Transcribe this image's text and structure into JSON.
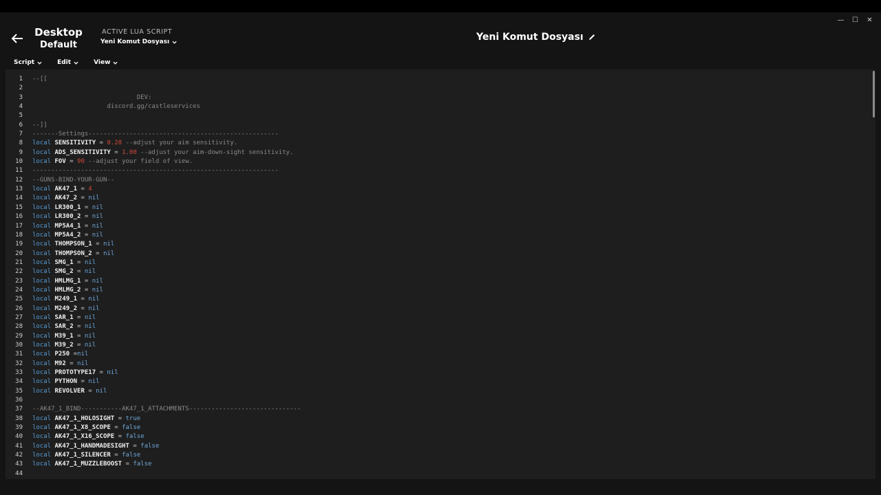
{
  "window": {
    "minimize": "—",
    "maximize": "☐",
    "close": "✕"
  },
  "profile": {
    "line1": "Desktop",
    "line2": "Default"
  },
  "active_script": {
    "label": "ACTIVE LUA SCRIPT",
    "selected": "Yeni Komut Dosyası"
  },
  "document": {
    "title": "Yeni Komut Dosyası"
  },
  "menu": {
    "script": "Script",
    "edit": "Edit",
    "view": "View"
  },
  "code_lines": [
    [
      [
        "c",
        "--[["
      ]
    ],
    [],
    [
      [
        "c",
        "                            DEV:"
      ]
    ],
    [
      [
        "c",
        "                    discord.gg/castleservices"
      ]
    ],
    [],
    [
      [
        "c",
        "--]]"
      ]
    ],
    [
      [
        "c",
        "-------Settings---------------------------------------------------"
      ]
    ],
    [
      [
        "k",
        "local "
      ],
      [
        "v",
        "SENSITIVITY"
      ],
      [
        "o",
        " = "
      ],
      [
        "n",
        "0.28"
      ],
      [
        "c",
        " --adjust your aim sensitivity."
      ]
    ],
    [
      [
        "k",
        "local "
      ],
      [
        "v",
        "ADS_SENSITIVITY"
      ],
      [
        "o",
        " = "
      ],
      [
        "n",
        "1.00"
      ],
      [
        "c",
        " --adjust your aim-down-sight sensitivity."
      ]
    ],
    [
      [
        "k",
        "local "
      ],
      [
        "v",
        "FOV"
      ],
      [
        "o",
        " = "
      ],
      [
        "n",
        "90"
      ],
      [
        "c",
        " --adjust your field of view."
      ]
    ],
    [
      [
        "c",
        "------------------------------------------------------------------"
      ]
    ],
    [
      [
        "c",
        "--GUNS-BIND-YOUR-GUN--"
      ]
    ],
    [
      [
        "k",
        "local "
      ],
      [
        "v",
        "AK47_1"
      ],
      [
        "o",
        " = "
      ],
      [
        "n",
        "4"
      ]
    ],
    [
      [
        "k",
        "local "
      ],
      [
        "v",
        "AK47_2"
      ],
      [
        "o",
        " = "
      ],
      [
        "p",
        "nil"
      ]
    ],
    [
      [
        "k",
        "local "
      ],
      [
        "v",
        "LR300_1"
      ],
      [
        "o",
        " = "
      ],
      [
        "p",
        "nil"
      ]
    ],
    [
      [
        "k",
        "local "
      ],
      [
        "v",
        "LR300_2"
      ],
      [
        "o",
        " = "
      ],
      [
        "p",
        "nil"
      ]
    ],
    [
      [
        "k",
        "local "
      ],
      [
        "v",
        "MP5A4_1"
      ],
      [
        "o",
        " = "
      ],
      [
        "p",
        "nil"
      ]
    ],
    [
      [
        "k",
        "local "
      ],
      [
        "v",
        "MP5A4_2"
      ],
      [
        "o",
        " = "
      ],
      [
        "p",
        "nil"
      ]
    ],
    [
      [
        "k",
        "local "
      ],
      [
        "v",
        "THOMPSON_1"
      ],
      [
        "o",
        " = "
      ],
      [
        "p",
        "nil"
      ]
    ],
    [
      [
        "k",
        "local "
      ],
      [
        "v",
        "THOMPSON_2"
      ],
      [
        "o",
        " = "
      ],
      [
        "p",
        "nil"
      ]
    ],
    [
      [
        "k",
        "local "
      ],
      [
        "v",
        "SMG_1"
      ],
      [
        "o",
        " = "
      ],
      [
        "p",
        "nil"
      ]
    ],
    [
      [
        "k",
        "local "
      ],
      [
        "v",
        "SMG_2"
      ],
      [
        "o",
        " = "
      ],
      [
        "p",
        "nil"
      ]
    ],
    [
      [
        "k",
        "local "
      ],
      [
        "v",
        "HMLMG_1"
      ],
      [
        "o",
        " = "
      ],
      [
        "p",
        "nil"
      ]
    ],
    [
      [
        "k",
        "local "
      ],
      [
        "v",
        "HMLMG_2"
      ],
      [
        "o",
        " = "
      ],
      [
        "p",
        "nil"
      ]
    ],
    [
      [
        "k",
        "local "
      ],
      [
        "v",
        "M249_1"
      ],
      [
        "o",
        " = "
      ],
      [
        "p",
        "nil"
      ]
    ],
    [
      [
        "k",
        "local "
      ],
      [
        "v",
        "M249_2"
      ],
      [
        "o",
        " = "
      ],
      [
        "p",
        "nil"
      ]
    ],
    [
      [
        "k",
        "local "
      ],
      [
        "v",
        "SAR_1"
      ],
      [
        "o",
        " = "
      ],
      [
        "p",
        "nil"
      ]
    ],
    [
      [
        "k",
        "local "
      ],
      [
        "v",
        "SAR_2"
      ],
      [
        "o",
        " = "
      ],
      [
        "p",
        "nil"
      ]
    ],
    [
      [
        "k",
        "local "
      ],
      [
        "v",
        "M39_1"
      ],
      [
        "o",
        " = "
      ],
      [
        "p",
        "nil"
      ]
    ],
    [
      [
        "k",
        "local "
      ],
      [
        "v",
        "M39_2"
      ],
      [
        "o",
        " = "
      ],
      [
        "p",
        "nil"
      ]
    ],
    [
      [
        "k",
        "local "
      ],
      [
        "v",
        "P250"
      ],
      [
        "o",
        " ="
      ],
      [
        "p",
        "nil"
      ]
    ],
    [
      [
        "k",
        "local "
      ],
      [
        "v",
        "M92"
      ],
      [
        "o",
        " = "
      ],
      [
        "p",
        "nil"
      ]
    ],
    [
      [
        "k",
        "local "
      ],
      [
        "v",
        "PROTOTYPE17"
      ],
      [
        "o",
        " = "
      ],
      [
        "p",
        "nil"
      ]
    ],
    [
      [
        "k",
        "local "
      ],
      [
        "v",
        "PYTHON"
      ],
      [
        "o",
        " = "
      ],
      [
        "p",
        "nil"
      ]
    ],
    [
      [
        "k",
        "local "
      ],
      [
        "v",
        "REVOLVER"
      ],
      [
        "o",
        " = "
      ],
      [
        "p",
        "nil"
      ]
    ],
    [],
    [
      [
        "c",
        "--AK47_1_BIND-----------AK47_1_ATTACHMENTS------------------------------"
      ]
    ],
    [
      [
        "k",
        "local "
      ],
      [
        "v",
        "AK47_1_HOLOSIGHT"
      ],
      [
        "o",
        " = "
      ],
      [
        "p",
        "true"
      ]
    ],
    [
      [
        "k",
        "local "
      ],
      [
        "v",
        "AK47_1_X8_SCOPE"
      ],
      [
        "o",
        " = "
      ],
      [
        "p",
        "false"
      ]
    ],
    [
      [
        "k",
        "local "
      ],
      [
        "v",
        "AK47_1_X16_SCOPE"
      ],
      [
        "o",
        " = "
      ],
      [
        "p",
        "false"
      ]
    ],
    [
      [
        "k",
        "local "
      ],
      [
        "v",
        "AK47_1_HANDMADESIGHT"
      ],
      [
        "o",
        " = "
      ],
      [
        "p",
        "false"
      ]
    ],
    [
      [
        "k",
        "local "
      ],
      [
        "v",
        "AK47_1_SILENCER"
      ],
      [
        "o",
        " = "
      ],
      [
        "p",
        "false"
      ]
    ],
    [
      [
        "k",
        "local "
      ],
      [
        "v",
        "AK47_1_MUZZLEBOOST"
      ],
      [
        "o",
        " = "
      ],
      [
        "p",
        "false"
      ]
    ],
    []
  ]
}
